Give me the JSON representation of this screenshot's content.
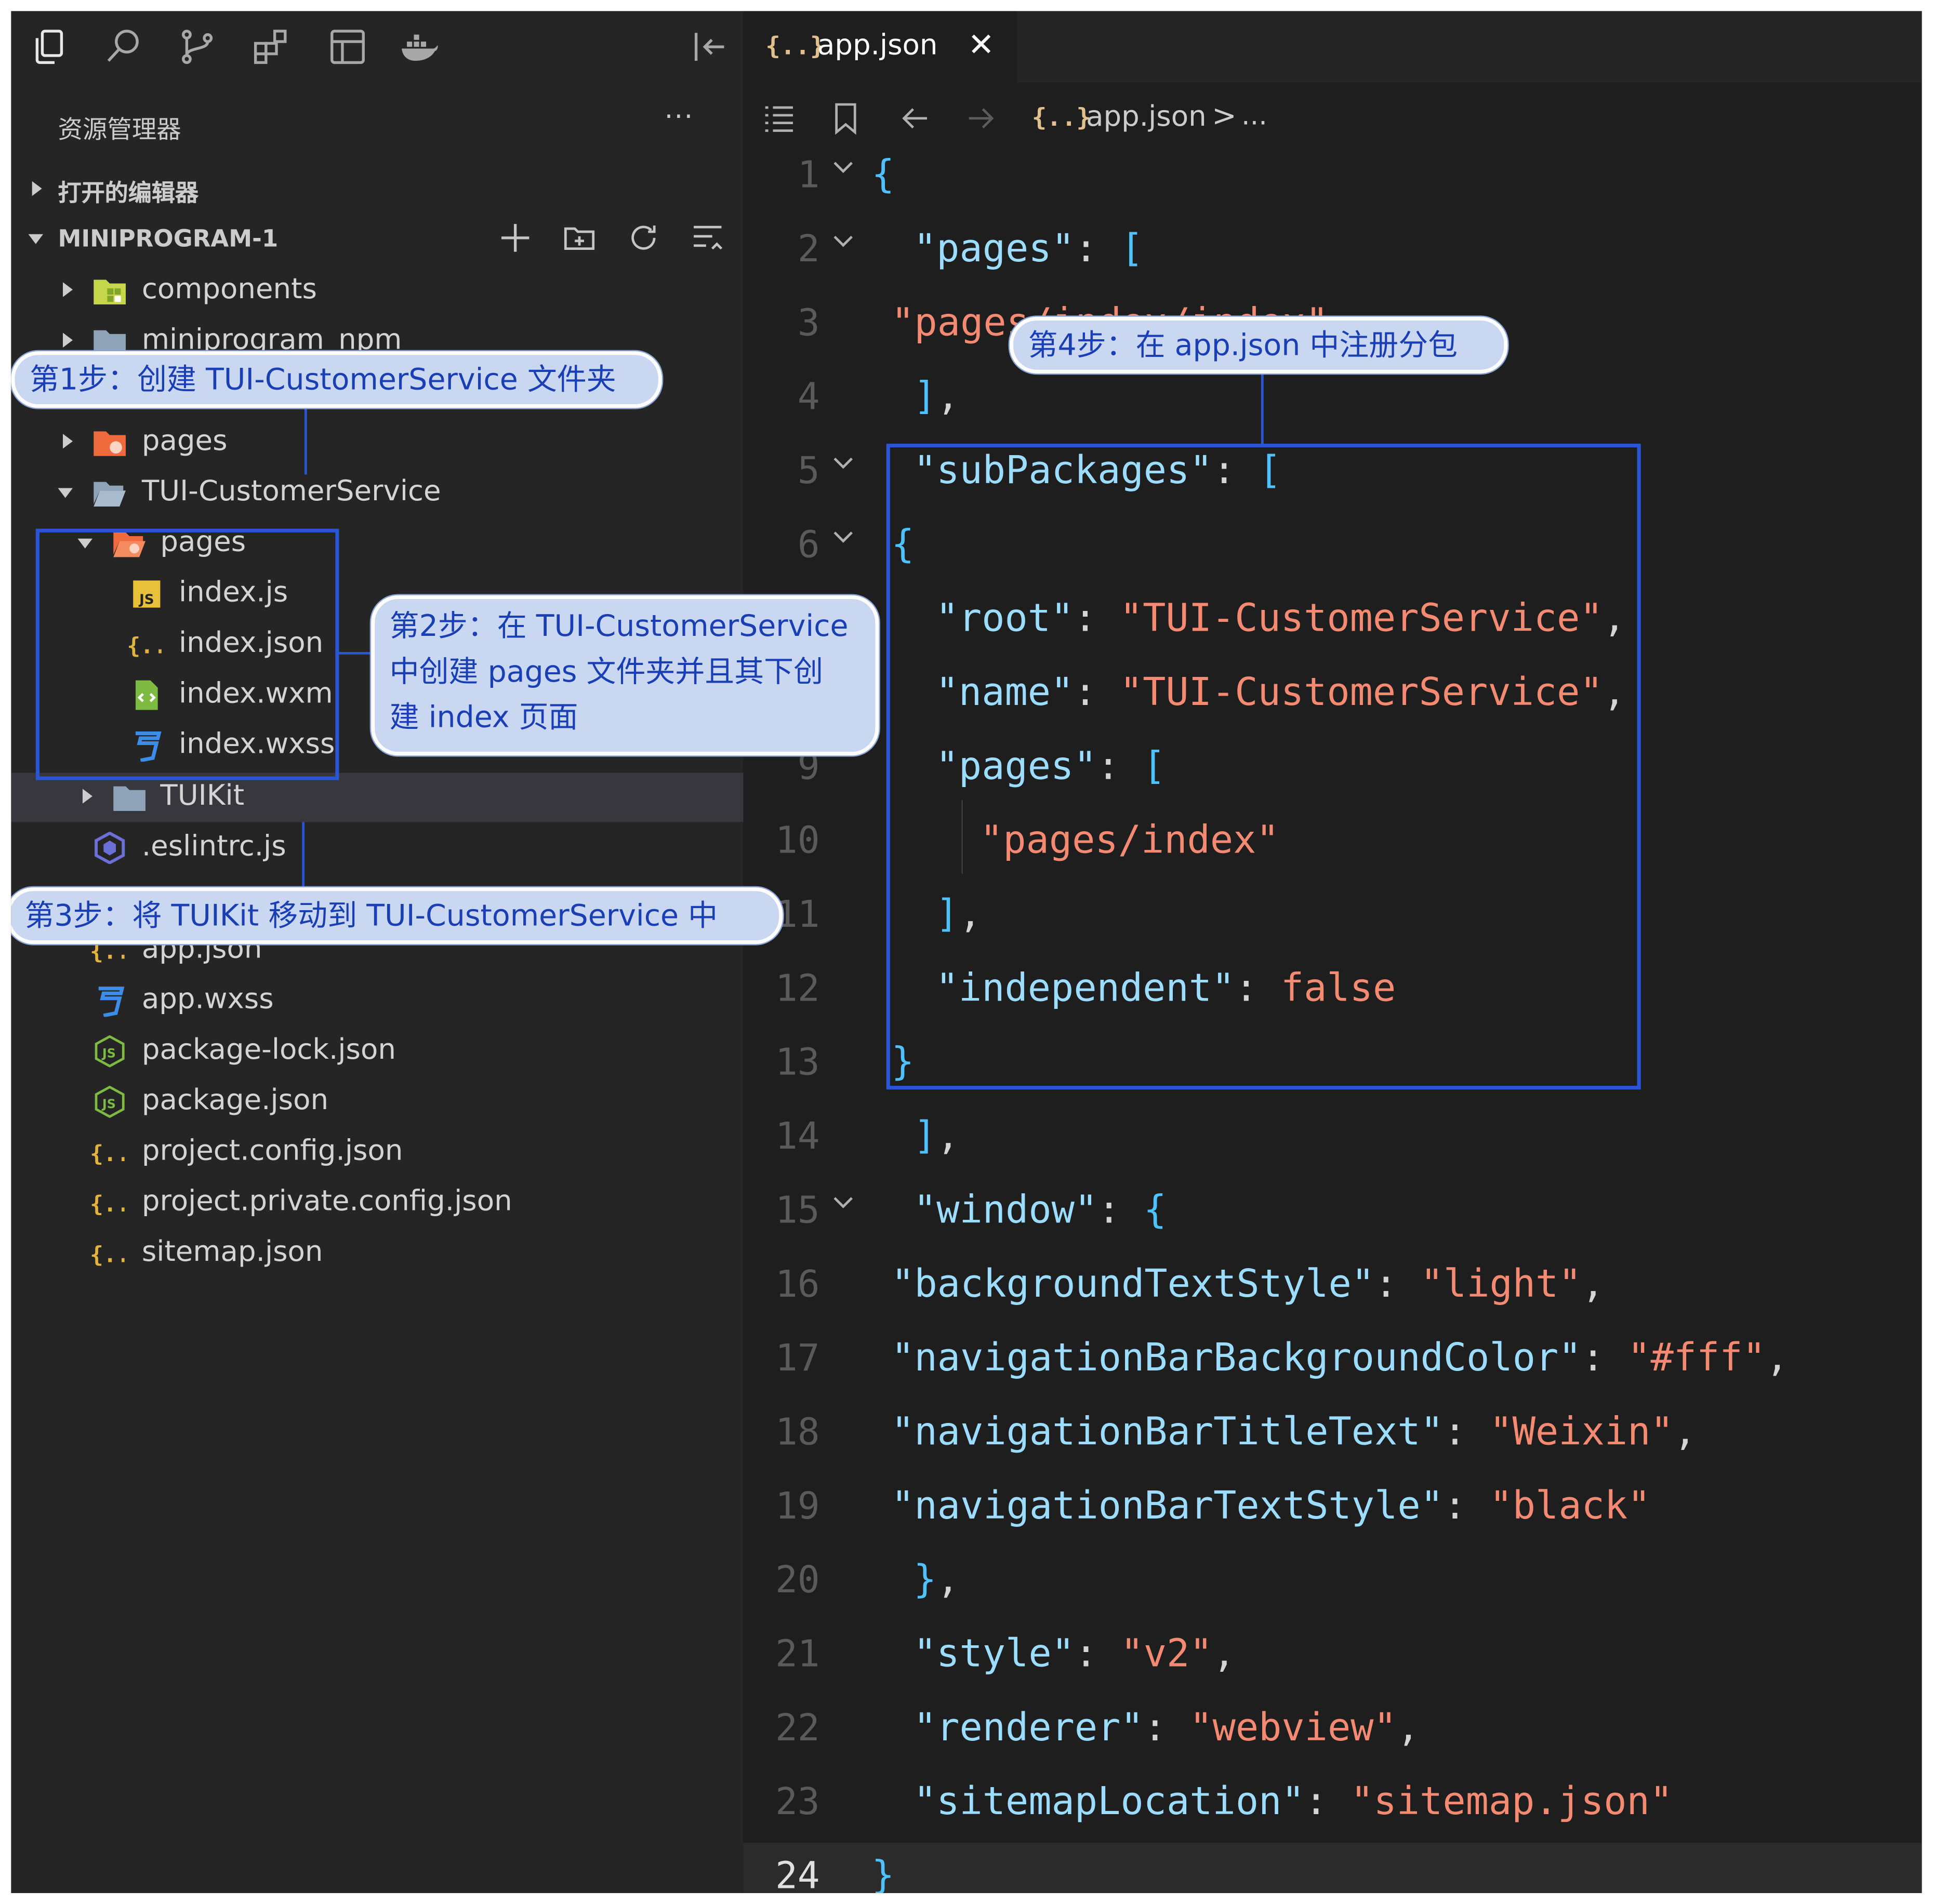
{
  "activity_bar": {
    "icons": [
      "files-icon",
      "search-icon",
      "source-control-icon",
      "extensions-icon",
      "layout-icon",
      "docker-icon"
    ],
    "collapse_icon": "panel-collapse-icon"
  },
  "explorer": {
    "title": "资源管理器",
    "more": "···",
    "open_editors_label": "打开的编辑器",
    "project_label": "MINIPROGRAM-1",
    "tree": {
      "components": "components",
      "miniprogram_npm": "miniprogram_npm",
      "pages": "pages",
      "tui_customer_service": "TUI-CustomerService",
      "sub_pages": "pages",
      "index_js": "index.js",
      "index_json": "index.json",
      "index_wxml": "index.wxml",
      "index_wxss": "index.wxss",
      "tuikit": "TUIKit",
      "eslintrc": ".eslintrc.js",
      "app_json": "app.json",
      "app_wxss": "app.wxss",
      "package_lock": "package-lock.json",
      "package_json": "package.json",
      "project_config": "project.config.json",
      "project_private_config": "project.private.config.json",
      "sitemap": "sitemap.json"
    }
  },
  "editor": {
    "tab_icon": "{..}",
    "tab_name": "app.json",
    "tab_close": "✕",
    "breadcrumb_icon": "{..}",
    "breadcrumb_file": "app.json",
    "breadcrumb_sep": ">",
    "breadcrumb_more": "...",
    "line_numbers": [
      "1",
      "2",
      "3",
      "4",
      "5",
      "6",
      "",
      "",
      "9",
      "10",
      "11",
      "12",
      "13",
      "14",
      "15",
      "16",
      "17",
      "18",
      "19",
      "20",
      "21",
      "22",
      "23",
      "24"
    ]
  },
  "callouts": {
    "step1": "第1步：创建 TUI-CustomerService 文件夹",
    "step2_line1": "第2步：在 TUI-CustomerService",
    "step2_line2": "中创建 pages 文件夹并且其下创",
    "step2_line3": "建 index 页面",
    "step3": "第3步：将 TUIKit 移动到 TUI-CustomerService 中",
    "step4": "第4步：在 app.json 中注册分包"
  },
  "colors": {
    "annotation_blue": "#2a55d4",
    "callout_bg": "#c9d7f0",
    "json_key": "#9cdcfe",
    "json_string": "#f58a72"
  }
}
